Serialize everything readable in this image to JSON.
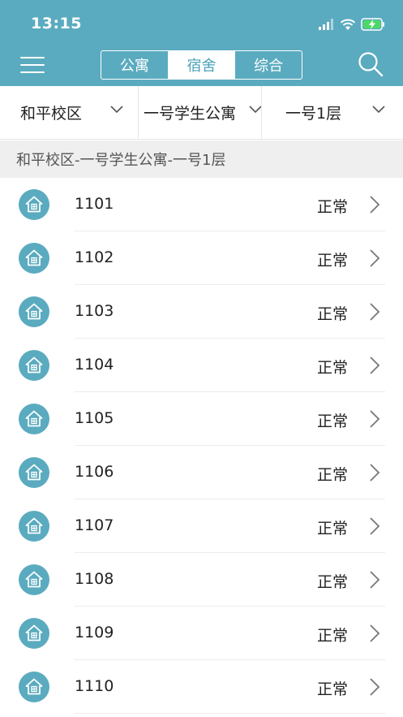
{
  "status_bar": {
    "time": "13:15"
  },
  "header": {
    "tabs": [
      {
        "label": "公寓",
        "active": false
      },
      {
        "label": "宿舍",
        "active": true
      },
      {
        "label": "综合",
        "active": false
      }
    ],
    "accent_color": "#5aabbf"
  },
  "filters": {
    "campus": "和平校区",
    "building": "一号学生公寓",
    "floor": "一号1层"
  },
  "breadcrumb": "和平校区-一号学生公寓-一号1层",
  "rooms": [
    {
      "number": "1101",
      "status": "正常"
    },
    {
      "number": "1102",
      "status": "正常"
    },
    {
      "number": "1103",
      "status": "正常"
    },
    {
      "number": "1104",
      "status": "正常"
    },
    {
      "number": "1105",
      "status": "正常"
    },
    {
      "number": "1106",
      "status": "正常"
    },
    {
      "number": "1107",
      "status": "正常"
    },
    {
      "number": "1108",
      "status": "正常"
    },
    {
      "number": "1109",
      "status": "正常"
    },
    {
      "number": "1110",
      "status": "正常"
    }
  ]
}
